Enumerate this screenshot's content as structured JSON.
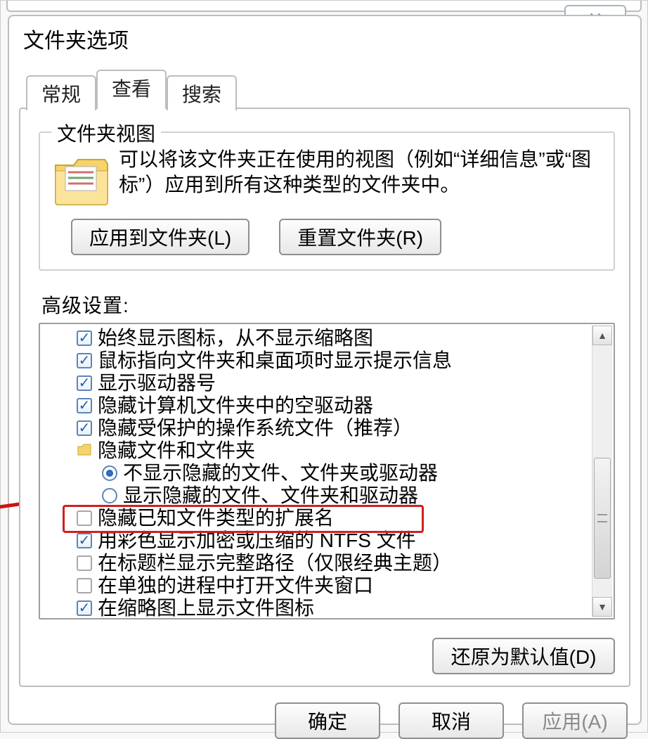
{
  "window": {
    "title": "文件夹选项",
    "close_glyph": "✕"
  },
  "tabs": {
    "general": "常规",
    "view": "查看",
    "search": "搜索"
  },
  "groupbox": {
    "legend": "文件夹视图",
    "description": "可以将该文件夹正在使用的视图（例如“详细信息”或“图标”）应用到所有这种类型的文件夹中。",
    "apply_btn": "应用到文件夹(L)",
    "reset_btn": "重置文件夹(R)"
  },
  "advanced_label": "高级设置:",
  "settings": [
    {
      "type": "check_on",
      "indent": 1,
      "label": "始终显示图标，从不显示缩略图"
    },
    {
      "type": "check_on",
      "indent": 1,
      "label": "鼠标指向文件夹和桌面项时显示提示信息"
    },
    {
      "type": "check_on",
      "indent": 1,
      "label": "显示驱动器号"
    },
    {
      "type": "check_on",
      "indent": 1,
      "label": "隐藏计算机文件夹中的空驱动器"
    },
    {
      "type": "check_on",
      "indent": 1,
      "label": "隐藏受保护的操作系统文件（推荐）"
    },
    {
      "type": "folder",
      "indent": 1,
      "label": "隐藏文件和文件夹"
    },
    {
      "type": "radio_on",
      "indent": 2,
      "label": "不显示隐藏的文件、文件夹或驱动器"
    },
    {
      "type": "radio_off",
      "indent": 2,
      "label": "显示隐藏的文件、文件夹和驱动器"
    },
    {
      "type": "check_off",
      "indent": 1,
      "label": "隐藏已知文件类型的扩展名",
      "highlight": true
    },
    {
      "type": "check_on",
      "indent": 1,
      "label": "用彩色显示加密或压缩的 NTFS 文件"
    },
    {
      "type": "check_off",
      "indent": 1,
      "label": "在标题栏显示完整路径（仅限经典主题）"
    },
    {
      "type": "check_off",
      "indent": 1,
      "label": "在单独的进程中打开文件夹窗口"
    },
    {
      "type": "check_on",
      "indent": 1,
      "label": "在缩略图上显示文件图标"
    }
  ],
  "restore_defaults": "还原为默认值(D)",
  "footer": {
    "ok": "确定",
    "cancel": "取消",
    "apply": "应用(A)"
  },
  "scroll": {
    "up": "▲",
    "down": "▼"
  }
}
